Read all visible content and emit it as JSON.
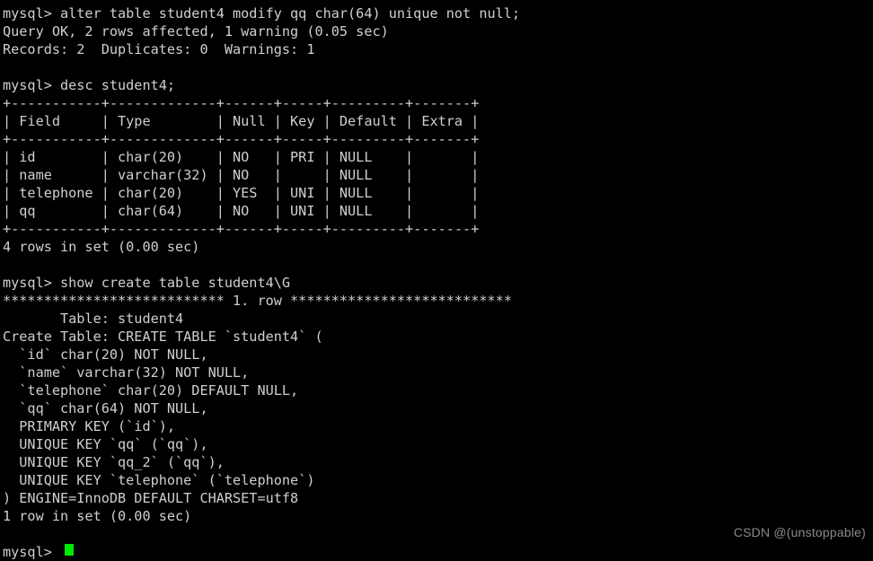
{
  "terminal": {
    "app": "mysql-client-terminal",
    "background_color": "#000000",
    "text_color": "#cfcfcf",
    "cursor_color": "#00e800",
    "lines": [
      "mysql> alter table student4 modify qq char(64) unique not null;",
      "Query OK, 2 rows affected, 1 warning (0.05 sec)",
      "Records: 2  Duplicates: 0  Warnings: 1",
      "",
      "mysql> desc student4;",
      "+-----------+-------------+------+-----+---------+-------+",
      "| Field     | Type        | Null | Key | Default | Extra |",
      "+-----------+-------------+------+-----+---------+-------+",
      "| id        | char(20)    | NO   | PRI | NULL    |       |",
      "| name      | varchar(32) | NO   |     | NULL    |       |",
      "| telephone | char(20)    | YES  | UNI | NULL    |       |",
      "| qq        | char(64)    | NO   | UNI | NULL    |       |",
      "+-----------+-------------+------+-----+---------+-------+",
      "4 rows in set (0.00 sec)",
      "",
      "mysql> show create table student4\\G",
      "*************************** 1. row ***************************",
      "       Table: student4",
      "Create Table: CREATE TABLE `student4` (",
      "  `id` char(20) NOT NULL,",
      "  `name` varchar(32) NOT NULL,",
      "  `telephone` char(20) DEFAULT NULL,",
      "  `qq` char(64) NOT NULL,",
      "  PRIMARY KEY (`id`),",
      "  UNIQUE KEY `qq` (`qq`),",
      "  UNIQUE KEY `qq_2` (`qq`),",
      "  UNIQUE KEY `telephone` (`telephone`)",
      ") ENGINE=InnoDB DEFAULT CHARSET=utf8",
      "1 row in set (0.00 sec)",
      ""
    ],
    "prompt": "mysql> ",
    "cursor": "block-cursor"
  },
  "commands": {
    "alter_statement": "alter table student4 modify qq char(64) unique not null;",
    "desc_statement": "desc student4;",
    "show_create_statement": "show create table student4\\G"
  },
  "results": {
    "alter_status": "Query OK, 2 rows affected, 1 warning (0.05 sec)",
    "alter_records": "Records: 2  Duplicates: 0  Warnings: 1",
    "desc_rowcount": "4 rows in set (0.00 sec)",
    "show_create_rowcount": "1 row in set (0.00 sec)"
  },
  "desc_table": {
    "columns": [
      "Field",
      "Type",
      "Null",
      "Key",
      "Default",
      "Extra"
    ],
    "rows": [
      [
        "id",
        "char(20)",
        "NO",
        "PRI",
        "NULL",
        ""
      ],
      [
        "name",
        "varchar(32)",
        "NO",
        "",
        "NULL",
        ""
      ],
      [
        "telephone",
        "char(20)",
        "YES",
        "UNI",
        "NULL",
        ""
      ],
      [
        "qq",
        "char(64)",
        "NO",
        "UNI",
        "NULL",
        ""
      ]
    ]
  },
  "create_table": {
    "row_header": "*************************** 1. row ***************************",
    "table_label": "Table:",
    "table_name": "student4",
    "create_label": "Create Table:",
    "definition_lines": [
      "CREATE TABLE `student4` (",
      "  `id` char(20) NOT NULL,",
      "  `name` varchar(32) NOT NULL,",
      "  `telephone` char(20) DEFAULT NULL,",
      "  `qq` char(64) NOT NULL,",
      "  PRIMARY KEY (`id`),",
      "  UNIQUE KEY `qq` (`qq`),",
      "  UNIQUE KEY `qq_2` (`qq`),",
      "  UNIQUE KEY `telephone` (`telephone`)",
      ") ENGINE=InnoDB DEFAULT CHARSET=utf8"
    ]
  },
  "watermark": {
    "text": "CSDN @(unstoppable)"
  }
}
